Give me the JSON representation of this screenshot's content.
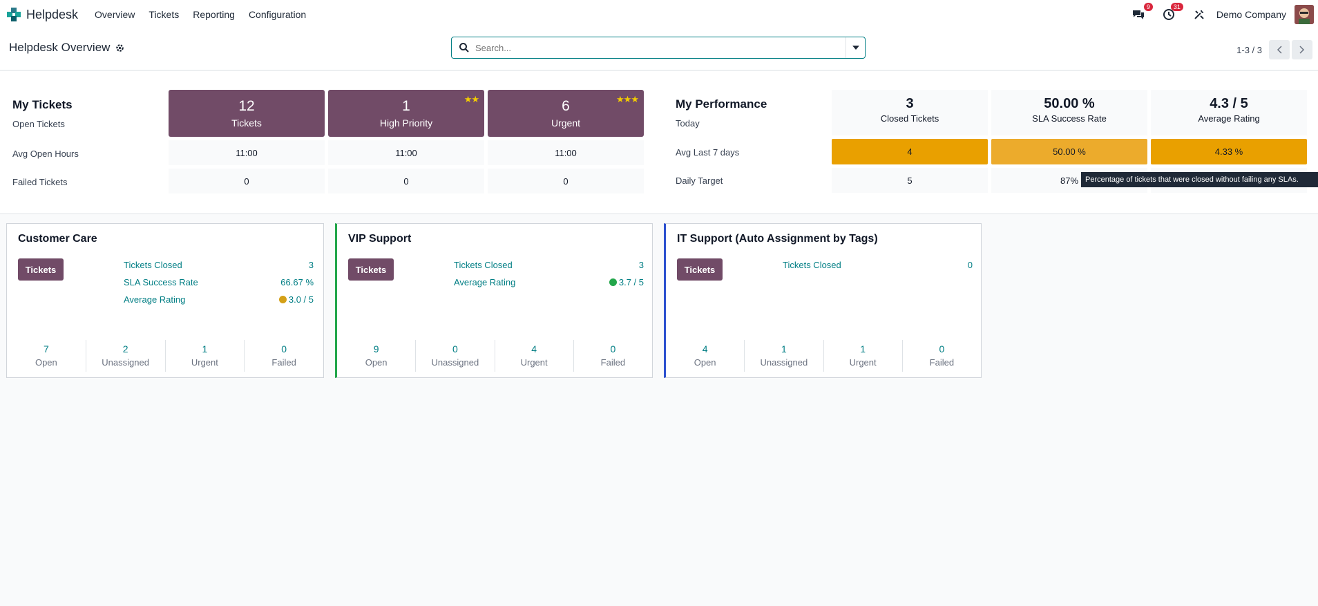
{
  "navbar": {
    "app_name": "Helpdesk",
    "menu": [
      "Overview",
      "Tickets",
      "Reporting",
      "Configuration"
    ],
    "messages_badge": "9",
    "activities_badge": "31",
    "company": "Demo Company"
  },
  "control": {
    "title": "Helpdesk Overview",
    "search_placeholder": "Search...",
    "pager": "1-3 / 3"
  },
  "my_tickets": {
    "title": "My Tickets",
    "open_label": "Open Tickets",
    "avg_label": "Avg Open Hours",
    "failed_label": "Failed Tickets",
    "tiles": [
      {
        "num": "12",
        "label": "Tickets",
        "stars": ""
      },
      {
        "num": "1",
        "label": "High Priority",
        "stars": "★★"
      },
      {
        "num": "6",
        "label": "Urgent",
        "stars": "★★★"
      }
    ],
    "avg_hours": [
      "11:00",
      "11:00",
      "11:00"
    ],
    "failed": [
      "0",
      "0",
      "0"
    ]
  },
  "my_performance": {
    "title": "My Performance",
    "today_label": "Today",
    "avg_label": "Avg Last 7 days",
    "target_label": "Daily Target",
    "heads": [
      {
        "num": "3",
        "label": "Closed Tickets"
      },
      {
        "num": "50.00 %",
        "label": "SLA Success Rate"
      },
      {
        "num": "4.3 / 5",
        "label": "Average Rating"
      }
    ],
    "avg": [
      "4",
      "50.00 %",
      "4.33 %"
    ],
    "target": [
      "5",
      "87%",
      ""
    ],
    "tooltip": "Percentage of tickets that were closed without failing any SLAs."
  },
  "teams": [
    {
      "name": "Customer Care",
      "accent": "",
      "button": "Tickets",
      "stats": [
        {
          "label": "Tickets Closed",
          "value": "3"
        },
        {
          "label": "SLA Success Rate",
          "value": "66.67 %"
        },
        {
          "label": "Average Rating",
          "value": "3.0 / 5",
          "smile": "#d4a017"
        }
      ],
      "counts": [
        {
          "n": "7",
          "l": "Open"
        },
        {
          "n": "2",
          "l": "Unassigned"
        },
        {
          "n": "1",
          "l": "Urgent"
        },
        {
          "n": "0",
          "l": "Failed"
        }
      ]
    },
    {
      "name": "VIP Support",
      "accent": "#22a64a",
      "button": "Tickets",
      "stats": [
        {
          "label": "Tickets Closed",
          "value": "3"
        },
        {
          "label": "Average Rating",
          "value": "3.7 / 5",
          "smile": "#22a64a"
        }
      ],
      "counts": [
        {
          "n": "9",
          "l": "Open"
        },
        {
          "n": "0",
          "l": "Unassigned"
        },
        {
          "n": "4",
          "l": "Urgent"
        },
        {
          "n": "0",
          "l": "Failed"
        }
      ]
    },
    {
      "name": "IT Support (Auto Assignment by Tags)",
      "accent": "#2b4fcf",
      "button": "Tickets",
      "stats": [
        {
          "label": "Tickets Closed",
          "value": "0"
        }
      ],
      "counts": [
        {
          "n": "4",
          "l": "Open"
        },
        {
          "n": "1",
          "l": "Unassigned"
        },
        {
          "n": "1",
          "l": "Urgent"
        },
        {
          "n": "0",
          "l": "Failed"
        }
      ]
    }
  ],
  "colors": {
    "primary": "#714b67",
    "teal": "#017e84",
    "amber_dark": "#e9a000",
    "amber_mid": "#ecab2c"
  }
}
